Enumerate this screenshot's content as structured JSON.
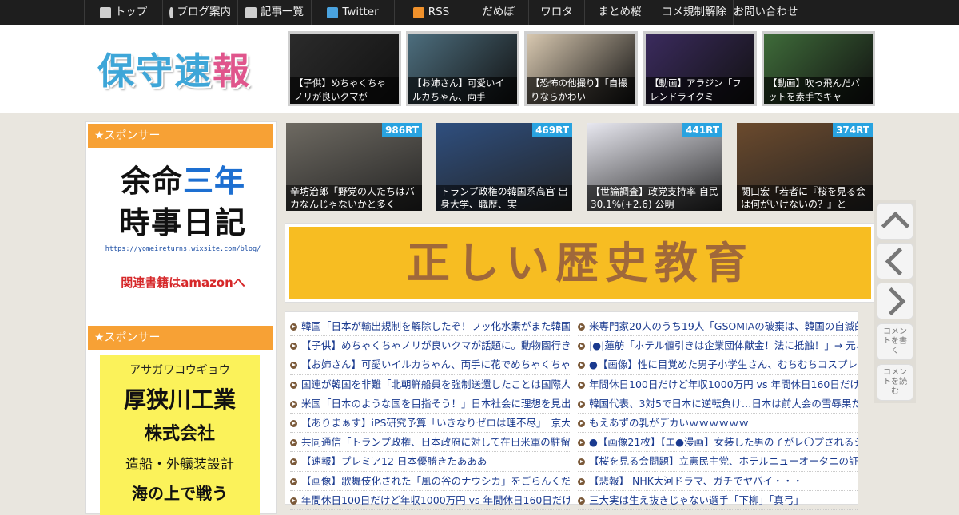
{
  "nav": [
    {
      "label": "トップ",
      "icon": "home-icon"
    },
    {
      "label": "ブログ案内",
      "icon": "info-icon"
    },
    {
      "label": "記事一覧",
      "icon": "list-icon"
    },
    {
      "label": "Twitter",
      "icon": "twitter-icon"
    },
    {
      "label": "RSS",
      "icon": "rss-icon"
    },
    {
      "label": "だめぽ"
    },
    {
      "label": "ワロタ"
    },
    {
      "label": "まとめ桜"
    },
    {
      "label": "コメ規制解除"
    },
    {
      "label": "お問い合わせ"
    }
  ],
  "colors": {
    "accent_orange": "#f7a135",
    "brand_blue": "#3ea6d8",
    "brand_pink": "#e0558c",
    "rt_badge": "#29a3e0",
    "banner_bg": "#f7bd22"
  },
  "logo": {
    "text_a": "保守速",
    "text_b": "報"
  },
  "header_thumbs": [
    {
      "caption": "【子供】めちゃくちゃノリが良いクマが",
      "color": "#2b2b2b"
    },
    {
      "caption": "【お姉さん】可愛いイルカちゃん、両手",
      "color": "#4d6e7e"
    },
    {
      "caption": "【恐怖の他撮り】「自撮りならかわい",
      "color": "#d9c9b1"
    },
    {
      "caption": "【動画】アラジン「フレンドライクミ",
      "color": "#3b2b5e"
    },
    {
      "caption": "【動画】吹っ飛んだバットを素手でキャ",
      "color": "#3f6c3a"
    }
  ],
  "sidebar": {
    "sponsor_label": "★スポンサー",
    "ad1": {
      "line1a": "余命",
      "line1b": "三年",
      "line2": "時事日記",
      "url": "https://yomeireturns.wixsite.com/blog/",
      "amazon": "関連書籍はamazonへ"
    },
    "ad2": {
      "kana": "アサガワコウギョウ",
      "name": "厚狭川工業",
      "corp": "株式会社",
      "desc": "造船・外艤装設計",
      "extra": "海の上で戦う"
    }
  },
  "ranking": [
    {
      "rt": "986RT",
      "caption": "辛坊治郎「野党の人たちはバカなんじゃないかと多く",
      "color": "#6e6a62"
    },
    {
      "rt": "469RT",
      "caption": "トランプ政権の韓国系高官 出身大学、職歴、実",
      "color": "#2f4f7f"
    },
    {
      "rt": "441RT",
      "caption": "【世論調査】政党支持率 自民30.1%(+2.6) 公明",
      "color": "#e8e8f0"
    },
    {
      "rt": "374RT",
      "caption": "関口宏「若者に『桜を見る会は何がいけないの？』と",
      "color": "#6b4a2d"
    }
  ],
  "banner": {
    "text": "正しい歴史教育"
  },
  "links_left": [
    "韓国「日本が輸出規制を解除したぞ！フッ化水素がまた韓国に",
    "【子供】めちゃくちゃノリが良いクマが話題に。動物園行きた",
    "【お姉さん】可愛いイルカちゃん、両手に花でめちゃくちゃご",
    "国連が韓国を非難「北朝鮮船員を強制送還したことは国際人権",
    "米国「日本のような国を目指そう！」日本社会に理想を見出す",
    "【ありまぁす】iPS研究予算「いきなりゼロは理不尽」　京大・",
    "共同通信「トランプ政権、日本政府に対して在日米軍の駐留経",
    "【速報】プレミア12 日本優勝きたあああ",
    "【画像】歌舞伎化された「風の谷のナウシカ」をごらんくださ",
    "年間休日100日だけど年収1000万円 vs 年間休日160日だけど年収"
  ],
  "links_right": [
    "米専門家20人のうち19人「GSOMIAの破棄は、韓国の自滅的行",
    "|●|蓮舫「ホテル値引きは企業団体献金！法に抵触！」→ 元ホテ",
    "●【画像】性に目覚めた男子小学生さん、むちむちコスプレイ",
    "年間休日100日だけど年収1000万円 vs 年間休日160日だけど年収",
    "韓国代表、3対5で日本に逆転負け…日本は前大会の雪辱果たし",
    "もえあずの乳がデカいｗｗｗｗｗｗ",
    "●【画像21枚】【エ●漫画】女装した男の子がレ〇プされるシチ",
    "【桜を見る会問題】立憲民主党、ホテルニューオータニの証人",
    "【悲報】 NHK大河ドラマ、ガチでヤバイ・・・",
    "三大実は生え抜きじゃない選手「下柳」「真弓」"
  ],
  "side_buttons": {
    "comment_write": "コメントを書く",
    "comment_read": "コメントを読む"
  }
}
